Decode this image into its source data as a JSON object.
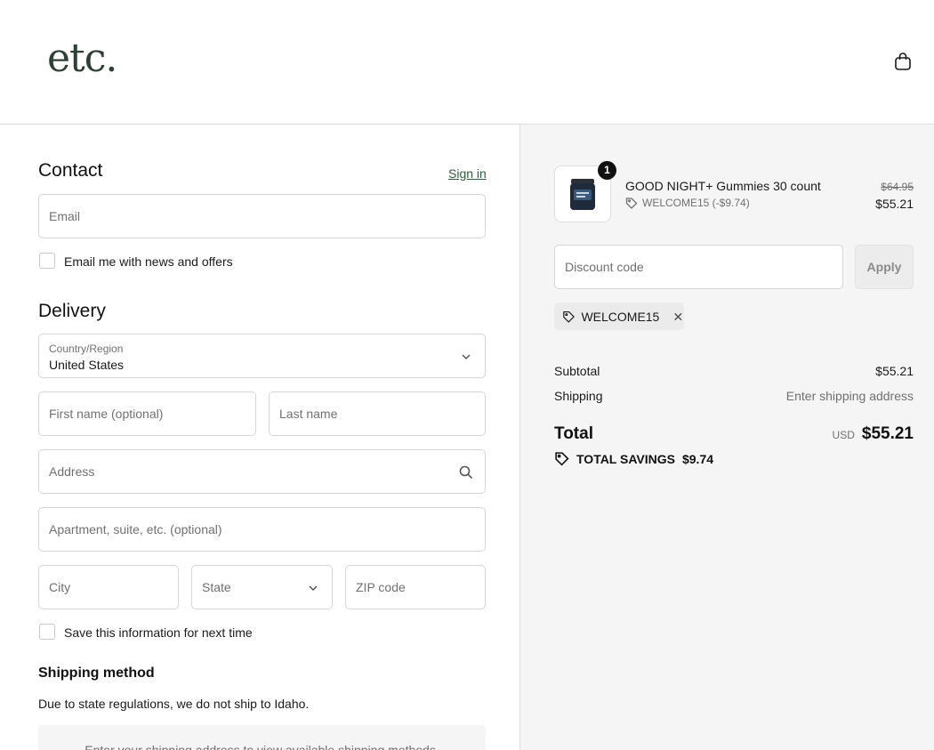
{
  "header": {
    "logo": "etc.",
    "cart_icon": "shopping-bag-icon"
  },
  "contact": {
    "title": "Contact",
    "sign_in": "Sign in",
    "email_placeholder": "Email",
    "newsletter_label": "Email me with news and offers"
  },
  "delivery": {
    "title": "Delivery",
    "country_label": "Country/Region",
    "country_value": "United States",
    "first_name_placeholder": "First name (optional)",
    "last_name_placeholder": "Last name",
    "address_placeholder": "Address",
    "apartment_placeholder": "Apartment, suite, etc. (optional)",
    "city_placeholder": "City",
    "state_placeholder": "State",
    "zip_placeholder": "ZIP code",
    "save_info_label": "Save this information for next time"
  },
  "shipping_method": {
    "title": "Shipping method",
    "notice": "Due to state regulations, we do not ship to Idaho.",
    "box_text": "Enter your shipping address to view available shipping methods."
  },
  "summary": {
    "product": {
      "quantity": "1",
      "name": "GOOD NIGHT+ Gummies 30 count",
      "discount": "WELCOME15 (-$9.74)",
      "original_price": "$64.95",
      "price": "$55.21"
    },
    "discount_placeholder": "Discount code",
    "apply_label": "Apply",
    "applied_code": "WELCOME15",
    "subtotal_label": "Subtotal",
    "subtotal_value": "$55.21",
    "shipping_label": "Shipping",
    "shipping_value": "Enter shipping address",
    "total_label": "Total",
    "currency": "USD",
    "total_value": "$55.21",
    "savings_label": "TOTAL SAVINGS",
    "savings_value": "$9.74"
  },
  "colors": {
    "brand": "#2e3f36",
    "link": "#2e5a3f",
    "summary_bg": "#f5f5f5"
  }
}
